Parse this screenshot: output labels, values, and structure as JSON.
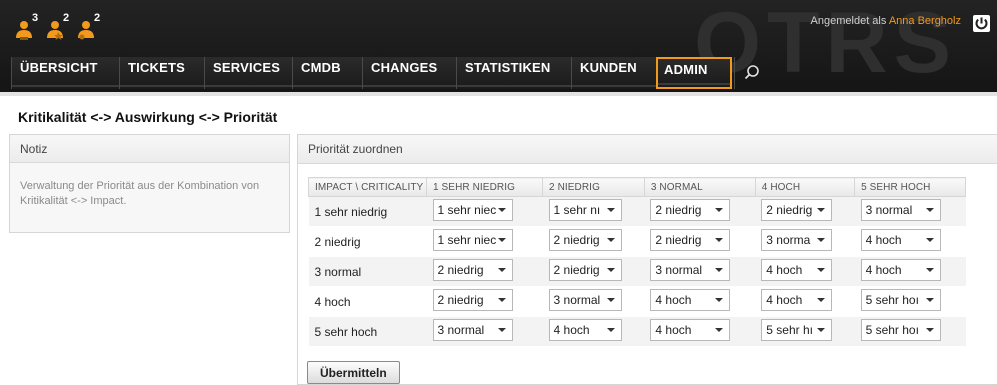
{
  "header": {
    "watermark": "OTRS",
    "toolbar": [
      {
        "icon": "locked-tickets-icon",
        "count": "3",
        "color": "#f39a1d"
      },
      {
        "icon": "watched-tickets-icon",
        "count": "2",
        "color": "#f39a1d"
      },
      {
        "icon": "responsible-tickets-icon",
        "count": "2",
        "color": "#f39a1d"
      }
    ],
    "login_prefix": "Angemeldet als",
    "user_name": "Anna Bergholz",
    "logout_icon": "power-icon",
    "search_icon": "search-icon"
  },
  "nav": {
    "items": [
      {
        "label": "ÜBERSICHT",
        "selected": false
      },
      {
        "label": "TICKETS",
        "selected": false
      },
      {
        "label": "SERVICES",
        "selected": false
      },
      {
        "label": "CMDB",
        "selected": false
      },
      {
        "label": "CHANGES",
        "selected": false
      },
      {
        "label": "STATISTIKEN",
        "selected": false
      },
      {
        "label": "KUNDEN",
        "selected": false
      },
      {
        "label": "ADMIN",
        "selected": true
      }
    ]
  },
  "page": {
    "title": "Kritikalität <-> Auswirkung <-> Priorität"
  },
  "sidebar": {
    "heading": "Notiz",
    "body": "Verwaltung der Priorität aus der Kombination von Kritikalität <-> Impact."
  },
  "main": {
    "heading": "Priorität zuordnen",
    "corner_header": "IMPACT \\ CRITICALITY",
    "column_headers": [
      "1 SEHR NIEDRIG",
      "2 NIEDRIG",
      "3 NORMAL",
      "4 HOCH",
      "5 SEHR HOCH"
    ],
    "rows": [
      {
        "label": "1 sehr niedrig",
        "values": [
          "1 sehr niec",
          "1 sehr nı",
          "2 niedrig",
          "2 niedrig",
          "3 normal"
        ]
      },
      {
        "label": "2 niedrig",
        "values": [
          "1 sehr niec",
          "2 niedrig",
          "2 niedrig",
          "3 norma",
          "4 hoch"
        ]
      },
      {
        "label": "3 normal",
        "values": [
          "2 niedrig",
          "2 niedrig",
          "3 normal",
          "4 hoch",
          "4 hoch"
        ]
      },
      {
        "label": "4 hoch",
        "values": [
          "2 niedrig",
          "3 normal",
          "4 hoch",
          "4 hoch",
          "5 sehr hoı"
        ]
      },
      {
        "label": "5 sehr hoch",
        "values": [
          "3 normal",
          "4 hoch",
          "4 hoch",
          "5 sehr hı",
          "5 sehr hoı"
        ]
      }
    ],
    "submit_label": "Übermitteln"
  },
  "colors": {
    "accent": "#f39a1d",
    "header_bg": "#1a1a1a"
  }
}
